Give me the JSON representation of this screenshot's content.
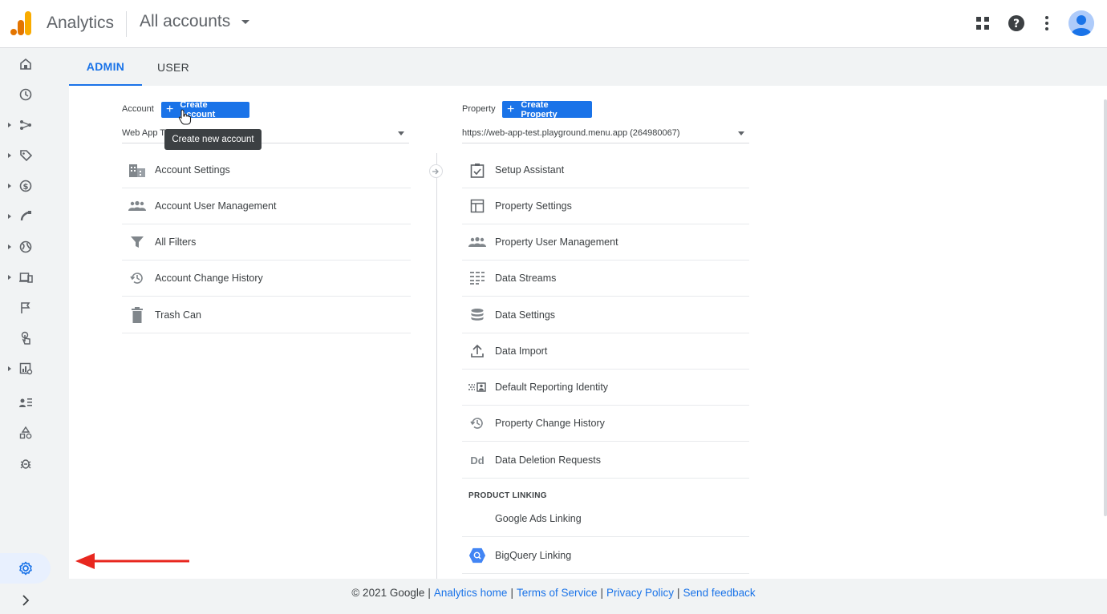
{
  "header": {
    "app_title": "Analytics",
    "account_switcher": "All accounts"
  },
  "icons": {
    "apps": "apps-grid-icon",
    "help": "help-icon",
    "more": "more-vert-icon",
    "avatar": "account-avatar"
  },
  "tabs": [
    {
      "label": "ADMIN",
      "active": true
    },
    {
      "label": "USER",
      "active": false
    }
  ],
  "account_column": {
    "label": "Account",
    "create_button": "Create Account",
    "selector_value": "Web App Te",
    "tooltip": "Create new account",
    "items": [
      {
        "label": "Account Settings",
        "icon": "building-icon"
      },
      {
        "label": "Account User Management",
        "icon": "people-icon"
      },
      {
        "label": "All Filters",
        "icon": "filter-icon"
      },
      {
        "label": "Account Change History",
        "icon": "history-icon"
      },
      {
        "label": "Trash Can",
        "icon": "trash-icon"
      }
    ]
  },
  "property_column": {
    "label": "Property",
    "create_button": "Create Property",
    "selector_value": "https://web-app-test.playground.menu.app (264980067)",
    "items": [
      {
        "label": "Setup Assistant",
        "icon": "checklist-icon"
      },
      {
        "label": "Property Settings",
        "icon": "layout-icon"
      },
      {
        "label": "Property User Management",
        "icon": "people-icon"
      },
      {
        "label": "Data Streams",
        "icon": "streams-icon"
      },
      {
        "label": "Data Settings",
        "icon": "database-icon"
      },
      {
        "label": "Data Import",
        "icon": "upload-icon"
      },
      {
        "label": "Default Reporting Identity",
        "icon": "identity-icon"
      },
      {
        "label": "Property Change History",
        "icon": "history-icon"
      },
      {
        "label": "Data Deletion Requests",
        "icon": "deletion-icon",
        "glyph": "Dd"
      }
    ],
    "product_linking_heading": "PRODUCT LINKING",
    "linking_items": [
      {
        "label": "Google Ads Linking",
        "icon": "google-ads-icon"
      },
      {
        "label": "BigQuery Linking",
        "icon": "bigquery-icon"
      }
    ]
  },
  "footer": {
    "copyright": "© 2021 Google",
    "links": [
      "Analytics home",
      "Terms of Service",
      "Privacy Policy",
      "Send feedback"
    ]
  },
  "colors": {
    "primary": "#1a73e8",
    "logo_orange": "#f9ab00",
    "logo_dark_orange": "#e37400",
    "annotation_red": "#e8271f"
  }
}
